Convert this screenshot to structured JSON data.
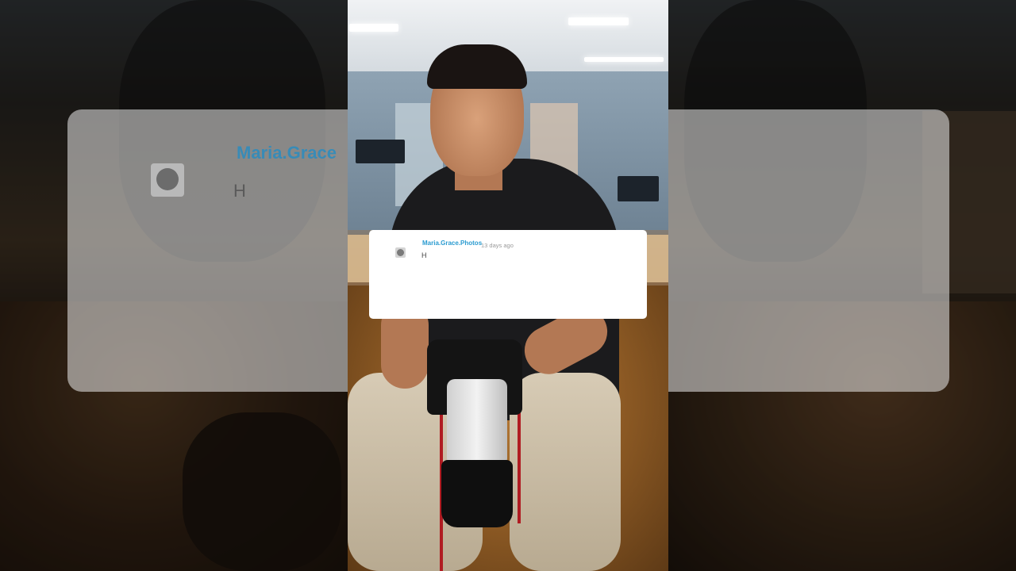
{
  "comment": {
    "username": "Maria.Grace.Photos",
    "timestamp": "13 days ago",
    "text": "H",
    "avatar_icon": "default-avatar-icon"
  },
  "ghost": {
    "username": "Maria.Grace",
    "text": "H"
  },
  "colors": {
    "username": "#2a9bd0",
    "card_background": "#ffffff",
    "timestamp": "#9a9a9a"
  }
}
